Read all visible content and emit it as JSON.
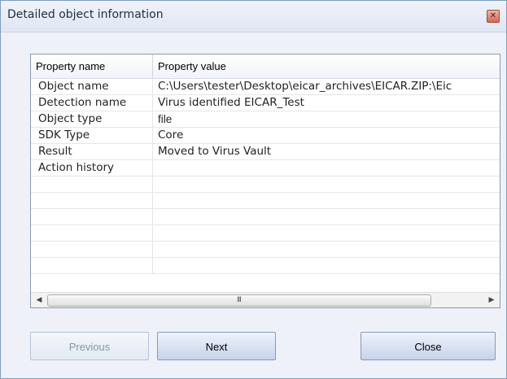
{
  "window": {
    "title": "Detailed object information",
    "close_glyph": "✕"
  },
  "table": {
    "columns": [
      "Property name",
      "Property value"
    ],
    "rows": [
      {
        "name": "Object name",
        "value": "C:\\Users\\tester\\Desktop\\eicar_archives\\EICAR.ZIP:\\Eic"
      },
      {
        "name": "Detection name",
        "value": "Virus identified EICAR_Test"
      },
      {
        "name": "Object type",
        "value": "file"
      },
      {
        "name": "SDK Type",
        "value": "Core"
      },
      {
        "name": "Result",
        "value": "Moved to Virus Vault"
      },
      {
        "name": "Action history",
        "value": ""
      },
      {
        "name": "",
        "value": ""
      },
      {
        "name": "",
        "value": ""
      },
      {
        "name": "",
        "value": ""
      },
      {
        "name": "",
        "value": ""
      },
      {
        "name": "",
        "value": ""
      },
      {
        "name": "",
        "value": ""
      },
      {
        "name": "",
        "value": ""
      }
    ]
  },
  "scrollbar": {
    "left_arrow": "◀",
    "right_arrow": "▶",
    "grip": "III"
  },
  "buttons": {
    "previous": "Previous",
    "next": "Next",
    "close": "Close"
  }
}
